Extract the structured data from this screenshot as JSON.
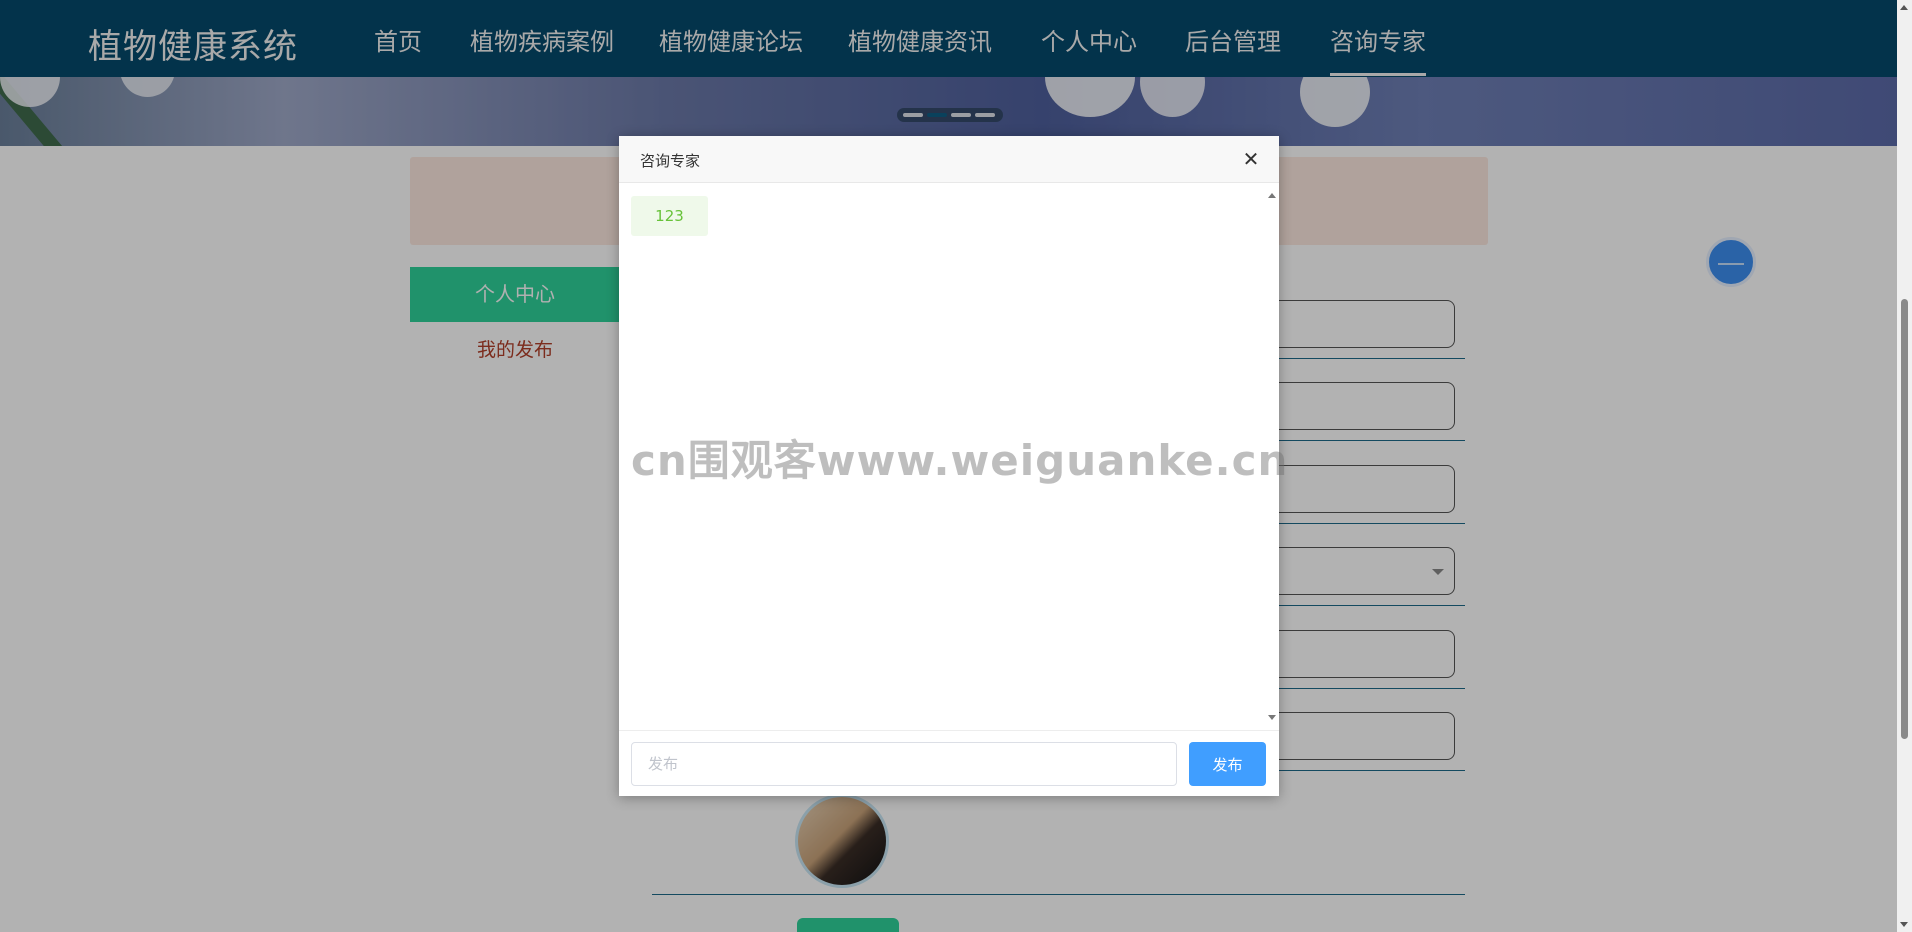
{
  "nav": {
    "brand": "植物健康系统",
    "items": [
      {
        "label": "首页"
      },
      {
        "label": "植物疾病案例"
      },
      {
        "label": "植物健康论坛"
      },
      {
        "label": "植物健康资讯"
      },
      {
        "label": "个人中心"
      },
      {
        "label": "后台管理"
      },
      {
        "label": "咨询专家",
        "active": true
      }
    ]
  },
  "banner": {
    "slide_count": 4,
    "active_index": 1
  },
  "sidebar": {
    "active_item": "个人中心",
    "items": [
      {
        "label": "我的发布"
      }
    ]
  },
  "modal": {
    "title": "咨询专家",
    "close_icon": "close-icon",
    "messages": [
      {
        "text": "123"
      }
    ],
    "watermark": "cn围观客www.weiguanke.cn",
    "input_placeholder": "发布",
    "send_label": "发布"
  },
  "colors": {
    "nav_bg": "#054a6c",
    "sidebar_active": "#2ed29a",
    "send_button": "#409eff",
    "message_text": "#67c23a"
  }
}
